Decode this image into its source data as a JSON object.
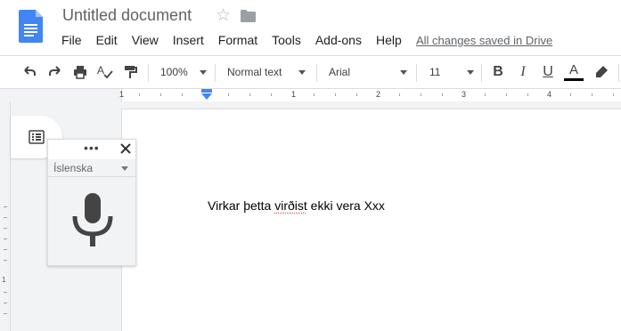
{
  "header": {
    "title": "Untitled document",
    "save_status": "All changes saved in Drive",
    "icons": [
      "docs-logo",
      "star-icon",
      "folder-icon"
    ]
  },
  "menu": [
    "File",
    "Edit",
    "View",
    "Insert",
    "Format",
    "Tools",
    "Add-ons",
    "Help"
  ],
  "toolbar": {
    "zoom": "100%",
    "style": "Normal text",
    "font": "Arial",
    "font_size": "11",
    "bold": "B",
    "italic": "I",
    "underline": "U",
    "text_color": "A",
    "icons": [
      "undo-icon",
      "redo-icon",
      "print-icon",
      "spellcheck-icon",
      "paint-format-icon",
      "highlighter-icon"
    ]
  },
  "ruler": {
    "numbers": [
      "1",
      "1",
      "2",
      "3",
      "4"
    ]
  },
  "left_ruler": {
    "numbers": [
      "1"
    ]
  },
  "voice_typing": {
    "dots": "•••",
    "close": "✕",
    "language": "Íslenska"
  },
  "document": {
    "text_before": "Virkar þetta ",
    "text_misspelled": "virðist",
    "text_after": " ekki vera Xxx"
  },
  "colors": {
    "accent_blue": "#4285f4",
    "text_color_underline": "#000000",
    "spellcheck": "#e06666"
  }
}
